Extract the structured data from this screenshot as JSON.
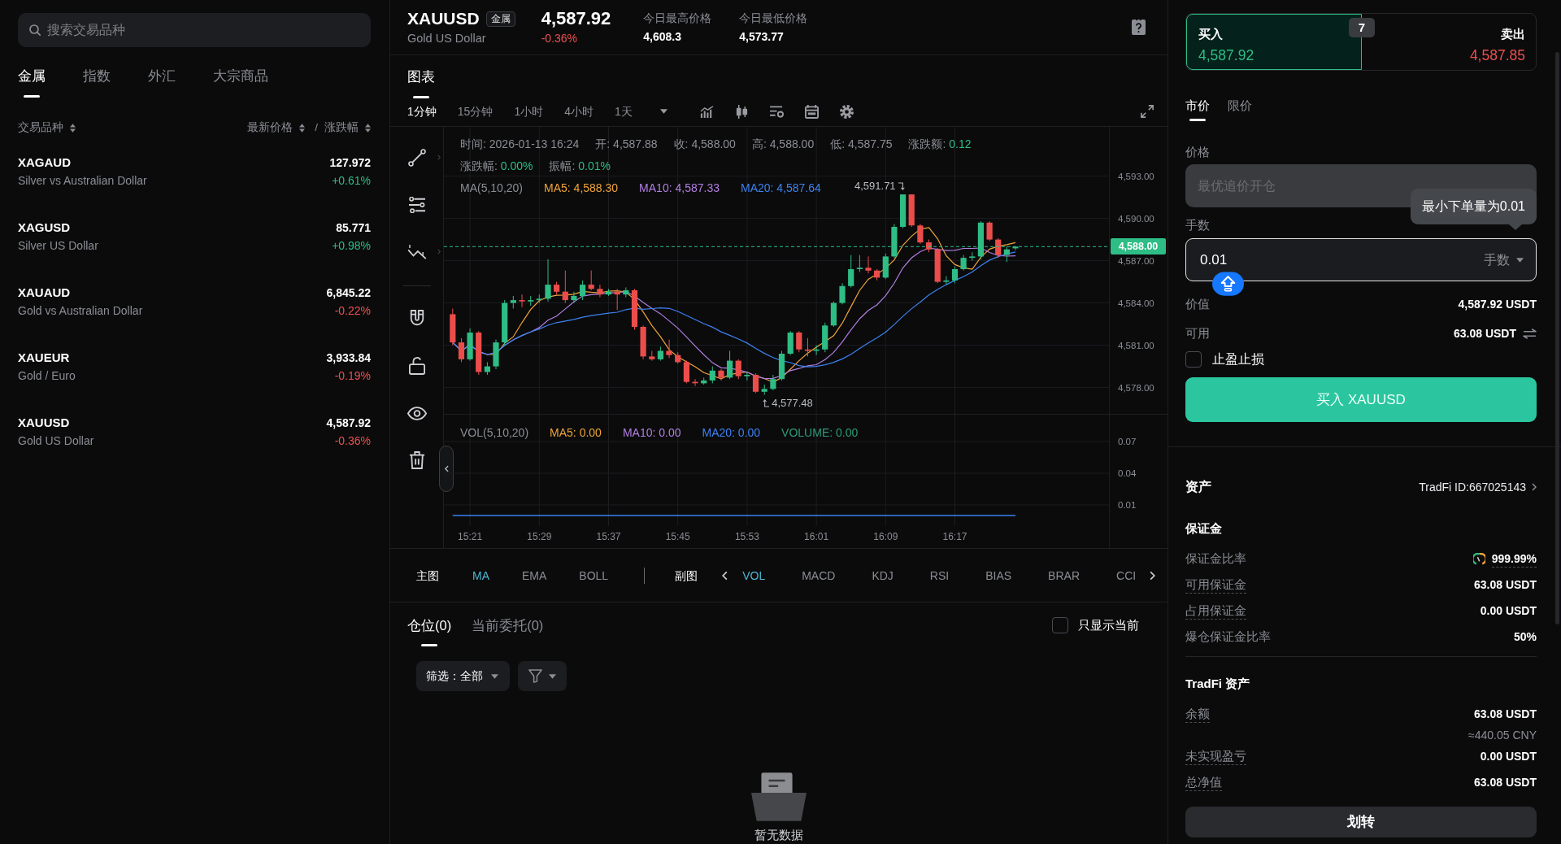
{
  "search": {
    "placeholder": "搜索交易品种"
  },
  "market_tabs": [
    {
      "label": "金属",
      "selected": true
    },
    {
      "label": "指数",
      "selected": false
    },
    {
      "label": "外汇",
      "selected": false
    },
    {
      "label": "大宗商品",
      "selected": false
    }
  ],
  "list_header": {
    "symbol": "交易品种",
    "price": "最新价格",
    "separator": "/",
    "change": "涨跌幅"
  },
  "instruments": [
    {
      "symbol": "XAGAUD",
      "name": "Silver vs Australian Dollar",
      "price": "127.972",
      "change": "+0.61%",
      "rising": true
    },
    {
      "symbol": "XAGUSD",
      "name": "Silver US Dollar",
      "price": "85.771",
      "change": "+0.98%",
      "rising": true
    },
    {
      "symbol": "XAUAUD",
      "name": "Gold vs Australian Dollar",
      "price": "6,845.22",
      "change": "-0.22%",
      "rising": false
    },
    {
      "symbol": "XAUEUR",
      "name": "Gold / Euro",
      "price": "3,933.84",
      "change": "-0.19%",
      "rising": false
    },
    {
      "symbol": "XAUUSD",
      "name": "Gold US Dollar",
      "price": "4,587.92",
      "change": "-0.36%",
      "rising": false
    }
  ],
  "quote": {
    "symbol": "XAUUSD",
    "category": "金属",
    "name": "Gold US Dollar",
    "price": "4,587.92",
    "change": "-0.36%",
    "rising": false,
    "stats": [
      {
        "label": "今日最高价格",
        "value": "4,608.3"
      },
      {
        "label": "今日最低价格",
        "value": "4,573.77"
      }
    ]
  },
  "chart_tabs": [
    {
      "label": "图表",
      "selected": true
    }
  ],
  "intervals": [
    {
      "label": "1分钟",
      "selected": true
    },
    {
      "label": "15分钟",
      "selected": false
    },
    {
      "label": "1小时",
      "selected": false
    },
    {
      "label": "4小时",
      "selected": false
    },
    {
      "label": "1天",
      "selected": false
    }
  ],
  "chart": {
    "info_rows": [
      [
        {
          "label": "时间:",
          "value": "2026-01-13 16:24",
          "accent": false
        },
        {
          "label": "开:",
          "value": "4,587.88",
          "accent": false
        },
        {
          "label": "收:",
          "value": "4,588.00",
          "accent": false
        },
        {
          "label": "高:",
          "value": "4,588.00",
          "accent": false
        },
        {
          "label": "低:",
          "value": "4,587.75",
          "accent": false
        },
        {
          "label": "涨跌额:",
          "value": "0.12",
          "accent": true
        }
      ],
      [
        {
          "label": "涨跌幅:",
          "value": "0.00%",
          "accent": true
        },
        {
          "label": "振幅:",
          "value": "0.01%",
          "accent": true
        }
      ]
    ],
    "ma_legend": {
      "title": "MA(5,10,20)",
      "items": [
        {
          "label": "MA5: 4,588.30",
          "color": "#f0a43a"
        },
        {
          "label": "MA10: 4,587.33",
          "color": "#b27fe0"
        },
        {
          "label": "MA20: 4,587.64",
          "color": "#3d82f0"
        }
      ]
    },
    "price_ticks": [
      "4,593.00",
      "4,590.00",
      "4,587.00",
      "4,584.00",
      "4,581.00",
      "4,578.00"
    ],
    "last_price": "4,588.00",
    "high_note": "4,591.71",
    "low_note": "4,577.48",
    "volume_legend": {
      "title": "VOL(5,10,20)",
      "items": [
        {
          "label": "MA5: 0.00",
          "color": "#f0a43a"
        },
        {
          "label": "MA10: 0.00",
          "color": "#b27fe0"
        },
        {
          "label": "MA20: 0.00",
          "color": "#3d82f0"
        },
        {
          "label": "VOLUME: 0.00",
          "color": "#2e9b78"
        }
      ]
    },
    "volume_ticks": [
      "0.07",
      "0.04",
      "0.01"
    ],
    "time_ticks": [
      "15:21",
      "15:29",
      "15:37",
      "15:45",
      "15:53",
      "16:01",
      "16:09",
      "16:17"
    ]
  },
  "indicators": {
    "main_label": "主图",
    "main": [
      {
        "label": "MA",
        "selected": true
      },
      {
        "label": "EMA",
        "selected": false
      },
      {
        "label": "BOLL",
        "selected": false
      }
    ],
    "sub_label": "副图",
    "sub": [
      {
        "label": "VOL",
        "selected": true
      },
      {
        "label": "MACD",
        "selected": false
      },
      {
        "label": "KDJ",
        "selected": false
      },
      {
        "label": "RSI",
        "selected": false
      },
      {
        "label": "BIAS",
        "selected": false
      },
      {
        "label": "BRAR",
        "selected": false
      },
      {
        "label": "CCI",
        "selected": false
      }
    ]
  },
  "positions": {
    "tabs": [
      {
        "label": "仓位(0)",
        "selected": true
      },
      {
        "label": "当前委托(0)",
        "selected": false
      }
    ],
    "current_only": {
      "label": "只显示当前",
      "checked": false
    },
    "filter_label": "筛选：全部",
    "empty_text": "暂无数据"
  },
  "order": {
    "sides": [
      {
        "label": "买入",
        "price": "4,587.92",
        "kind": "buy",
        "selected": true
      },
      {
        "label": "卖出",
        "price": "4,587.85",
        "kind": "sell",
        "selected": false
      }
    ],
    "spread": "7",
    "types": [
      {
        "label": "市价",
        "selected": true
      },
      {
        "label": "限价",
        "selected": false
      }
    ],
    "price_label": "价格",
    "price_field": {
      "placeholder": "最优追价开仓",
      "disabled": true
    },
    "tooltip": "最小下单量为0.01",
    "qty_label": "手数",
    "qty_value": "0.01",
    "qty_unit": "手数",
    "summary": [
      {
        "label": "价值",
        "value": "4,587.92 USDT",
        "kind": "plain"
      },
      {
        "label": "可用",
        "value": "63.08 USDT",
        "kind": "transfer"
      }
    ],
    "tpsl": {
      "label": "止盈止损",
      "checked": false
    },
    "submit": "买入 XAUUSD"
  },
  "assets": {
    "title": "资产",
    "account": "TradFi ID:667025143",
    "groups": [
      {
        "title": "保证金",
        "rows": [
          {
            "label": "保证金比率",
            "value": "999.99%",
            "kind": "ratio",
            "hint": false
          },
          {
            "label": "可用保证金",
            "value": "63.08 USDT",
            "kind": "plain",
            "hint": true
          },
          {
            "label": "占用保证金",
            "value": "0.00 USDT",
            "kind": "plain",
            "hint": true
          },
          {
            "label": "爆仓保证金比率",
            "value": "50%",
            "kind": "plain",
            "hint": false
          }
        ]
      },
      {
        "title": "TradFi 资产",
        "rows": [
          {
            "label": "余额",
            "value": "63.08 USDT",
            "note": "≈440.05 CNY",
            "kind": "plain",
            "hint": true
          },
          {
            "label": "未实现盈亏",
            "value": "0.00 USDT",
            "kind": "plain",
            "hint": true
          },
          {
            "label": "总净值",
            "value": "63.08 USDT",
            "kind": "plain",
            "hint": true
          }
        ]
      }
    ],
    "transfer": "划转"
  }
}
